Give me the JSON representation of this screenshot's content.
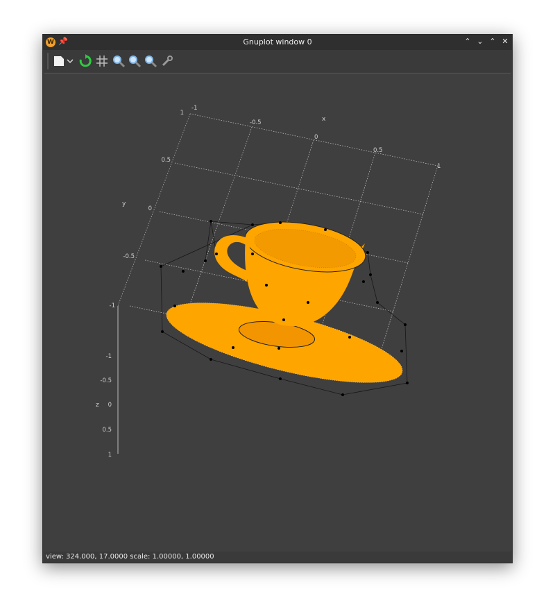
{
  "window": {
    "title": "Gnuplot window 0",
    "app_icon_letter": "W"
  },
  "toolbar": {
    "buttons": [
      "copy-clipboard-icon",
      "dropdown-chevron-icon",
      "replot-icon",
      "grid-icon",
      "zoom-previous-icon",
      "zoom-next-icon",
      "autoscale-icon",
      "configuration-icon"
    ]
  },
  "status": {
    "text": "view: 324.000,  17.0000   scale:  1.00000,  1.00000"
  },
  "colors": {
    "surface": "#ffa500",
    "background": "#3f3f3f",
    "grid": "#bdbdbd",
    "text": "#d0d0d0"
  },
  "chart_data": {
    "type": "scatter",
    "title": "",
    "xlabel": "x",
    "ylabel": "y",
    "zlabel": "z",
    "x_ticks": [
      "-1",
      "-0.5",
      "0",
      "0.5",
      "1"
    ],
    "y_ticks": [
      "1",
      "0.5",
      "0",
      "-0.5",
      "-1"
    ],
    "z_ticks": [
      "-1",
      "-0.5",
      "0",
      "0.5",
      "1"
    ],
    "xlim": [
      -1,
      1
    ],
    "ylim": [
      -1,
      1
    ],
    "zlim": [
      -1,
      1
    ],
    "view": {
      "rot_x": 324.0,
      "rot_z": 17.0,
      "scale": [
        1.0,
        1.0
      ]
    },
    "grid": true,
    "series": []
  }
}
